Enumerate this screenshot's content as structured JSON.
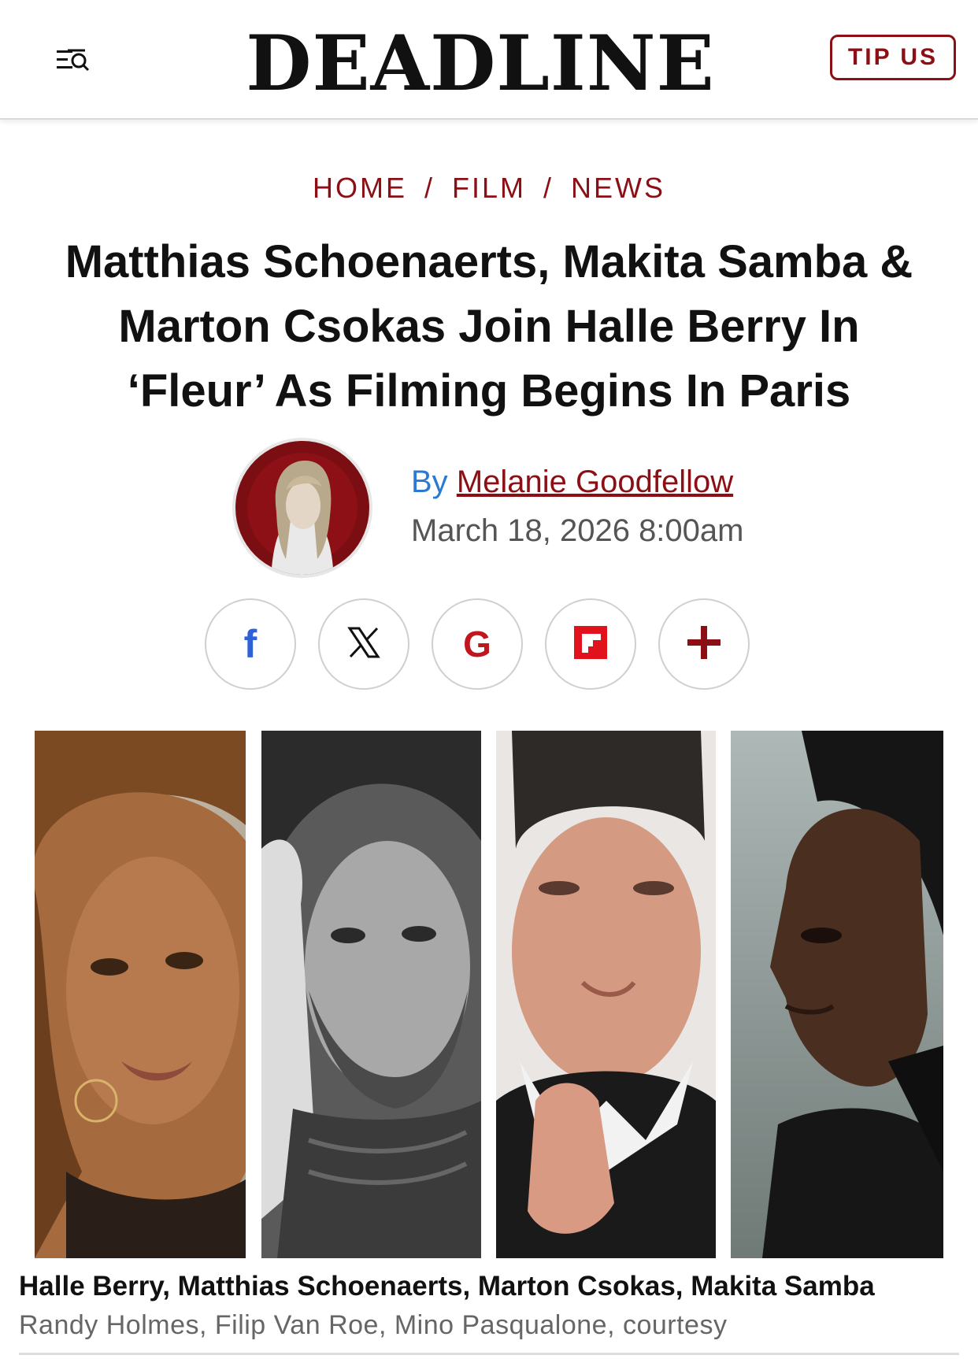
{
  "header": {
    "logo": "DEADLINE",
    "tip_label": "TIP US",
    "menu_icon": "menu-search-icon"
  },
  "breadcrumb": [
    "HOME",
    "FILM",
    "NEWS"
  ],
  "breadcrumb_separator": "/",
  "article": {
    "title_lines": [
      "Matthias Schoenaerts, Makita Samba &",
      "Marton Csokas Join Halle Berry In",
      "‘Fleur’ As Filming Begins In Paris"
    ],
    "by_prefix": "By",
    "author": "Melanie Goodfellow",
    "date": "March 18, 2026 8:00am"
  },
  "share": [
    {
      "icon": "facebook-icon",
      "glyph": "f",
      "color": "#2f62d6"
    },
    {
      "icon": "x-icon",
      "glyph": "𝕏",
      "color": "#111111"
    },
    {
      "icon": "google-icon",
      "glyph": "G",
      "color": "#c0161e"
    },
    {
      "icon": "flipboard-icon",
      "glyph": "",
      "color": "#e1121b"
    },
    {
      "icon": "plus-icon",
      "glyph": "+",
      "color": "#8b0f14"
    }
  ],
  "image": {
    "caption": "Halle Berry, Matthias Schoenaerts, Marton Csokas, Makita Samba",
    "credit": "Randy Holmes, Filip Van Roe, Mino Pasqualone, courtesy"
  },
  "colors": {
    "accent": "#8b0f14",
    "byline_blue": "#2a7ad4"
  }
}
